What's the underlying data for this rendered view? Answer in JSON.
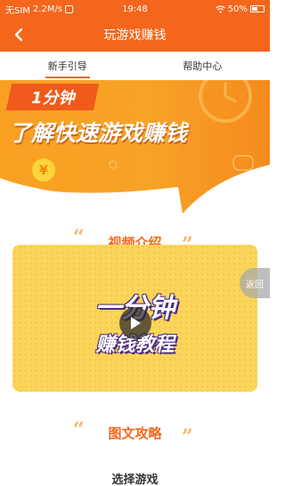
{
  "status_bar": {
    "carrier": "无SIM",
    "speed": "2.2M/s",
    "time": "19:48",
    "battery": "50%"
  },
  "header": {
    "title": "玩游戏赚钱"
  },
  "tabs": [
    {
      "label": "新手引导",
      "active": true
    },
    {
      "label": "帮助中心",
      "active": false
    }
  ],
  "banner": {
    "tag": "1分钟",
    "headline": "了解快速游戏赚钱"
  },
  "sections": {
    "video": {
      "title": "视频介绍",
      "card_line1": "一分钟",
      "card_line2": "赚钱教程"
    },
    "guide": {
      "title": "图文攻略"
    }
  },
  "float_button": "返回",
  "bottom_text": "选择游戏",
  "colors": {
    "primary": "#f4661c",
    "card_yellow": "#fbd55a",
    "quote": "#f7b36a"
  }
}
